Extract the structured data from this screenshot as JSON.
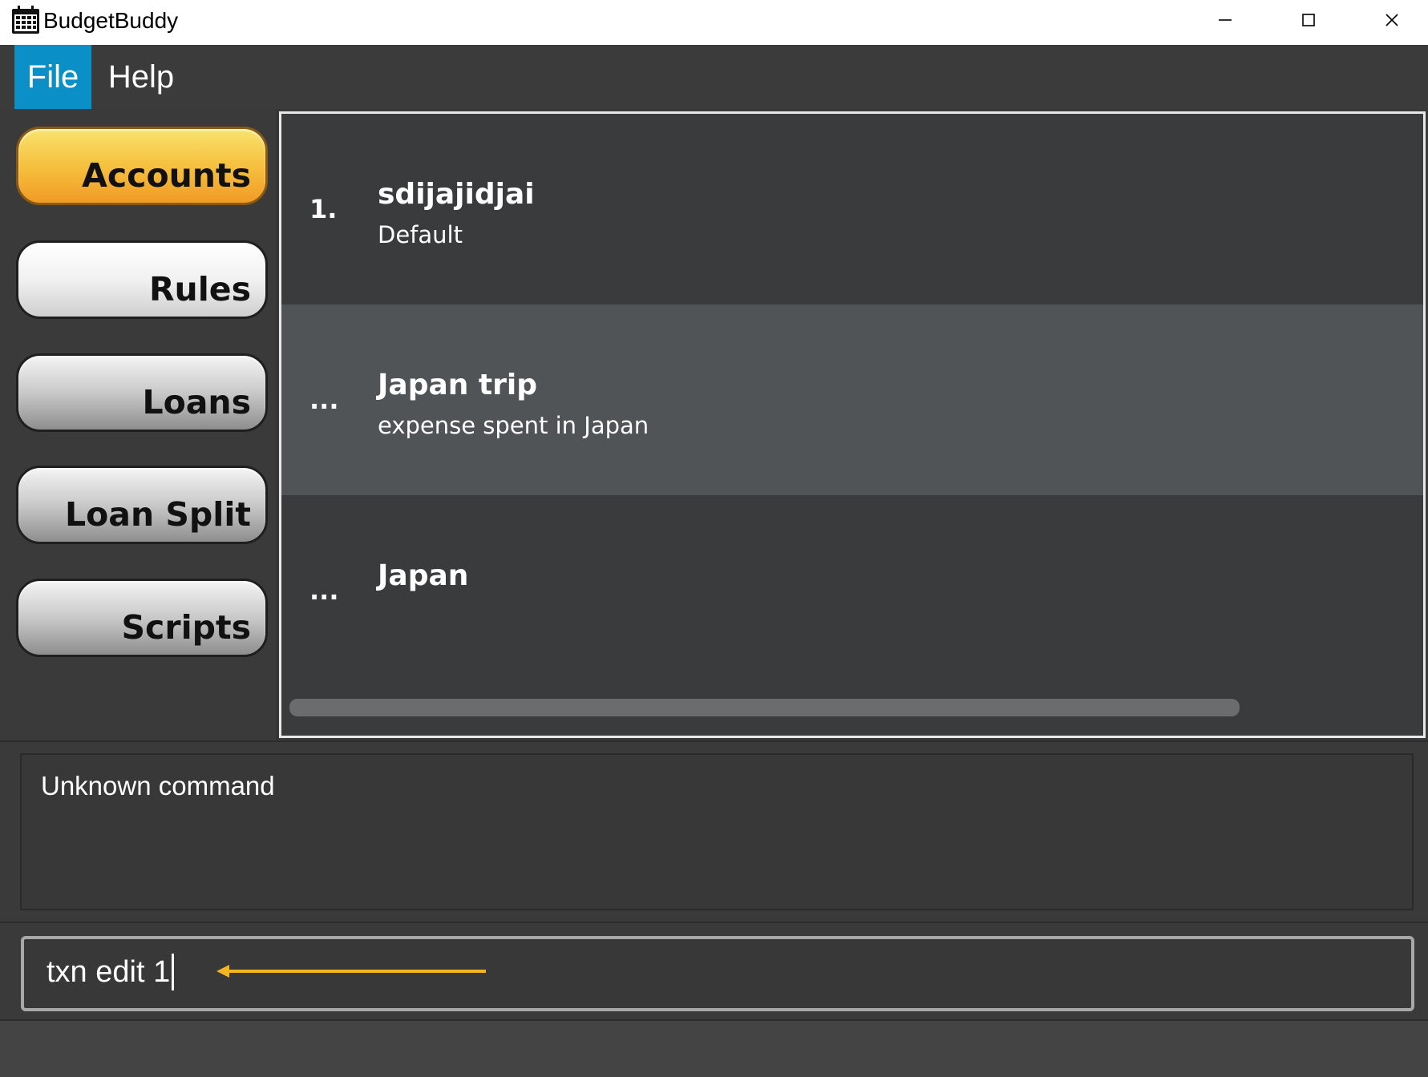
{
  "window": {
    "title": "BudgetBuddy"
  },
  "menu": {
    "items": [
      {
        "label": "File"
      },
      {
        "label": "Help"
      }
    ]
  },
  "sidebar": {
    "buttons": [
      {
        "label": "Accounts"
      },
      {
        "label": "Rules"
      },
      {
        "label": "Loans"
      },
      {
        "label": "Loan Split"
      },
      {
        "label": "Scripts"
      }
    ]
  },
  "list": {
    "rows": [
      {
        "index": "1.",
        "title": "sdijajidjai",
        "description": "Default"
      },
      {
        "index": "...",
        "title": "Japan trip",
        "description": "expense spent in Japan"
      },
      {
        "index": "...",
        "title": "Japan",
        "description": ""
      }
    ]
  },
  "result": {
    "text": "Unknown command"
  },
  "command": {
    "value": "txn edit 1"
  },
  "colors": {
    "accent": "#0a8fc6",
    "annotation_arrow": "#f3b61f",
    "active_button": "#f6bd3b"
  }
}
